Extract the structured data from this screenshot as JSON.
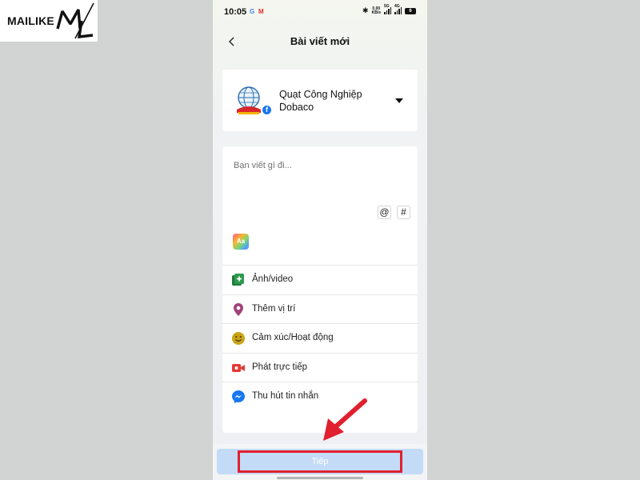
{
  "watermark": {
    "text": "MAILIKE",
    "logo": "ML-logo"
  },
  "status_bar": {
    "time": "10:05",
    "g_indicator": "G",
    "gmail_indicator": "M",
    "net_speed_value": "0,00",
    "net_speed_unit": "KB/s",
    "signal_5g_label": "5G",
    "signal_4g_label": "4G",
    "battery_level": "6",
    "icons": [
      "google-icon",
      "gmail-icon",
      "bluetooth-icon",
      "signal-icon",
      "battery-icon"
    ]
  },
  "header": {
    "title": "Bài viết mới",
    "back_icon": "chevron-left-icon"
  },
  "account": {
    "name": "Quạt Công Nghiệp Dobaco",
    "badge_icon": "facebook-icon",
    "dropdown_icon": "caret-down-icon"
  },
  "composer": {
    "placeholder": "Bạn viết gì đi...",
    "mention_symbol": "@",
    "hashtag_symbol": "#",
    "text_style_label": "Aa"
  },
  "actions": [
    {
      "label": "Ảnh/video",
      "icon": "photo-add-icon",
      "color": "#2e9a4f"
    },
    {
      "label": "Thêm vị trí",
      "icon": "location-pin-icon",
      "color": "#a2437a"
    },
    {
      "label": "Cảm xúc/Hoạt động",
      "icon": "smiley-icon",
      "color": "#c9a316"
    },
    {
      "label": "Phát trực tiếp",
      "icon": "live-video-icon",
      "color": "#e53935"
    },
    {
      "label": "Thu hút tin nhắn",
      "icon": "messenger-icon",
      "color": "#1877f2"
    }
  ],
  "footer": {
    "next_label": "Tiếp"
  },
  "annotation": {
    "highlight_color": "#e0202e",
    "arrow_icon": "red-arrow-icon"
  }
}
